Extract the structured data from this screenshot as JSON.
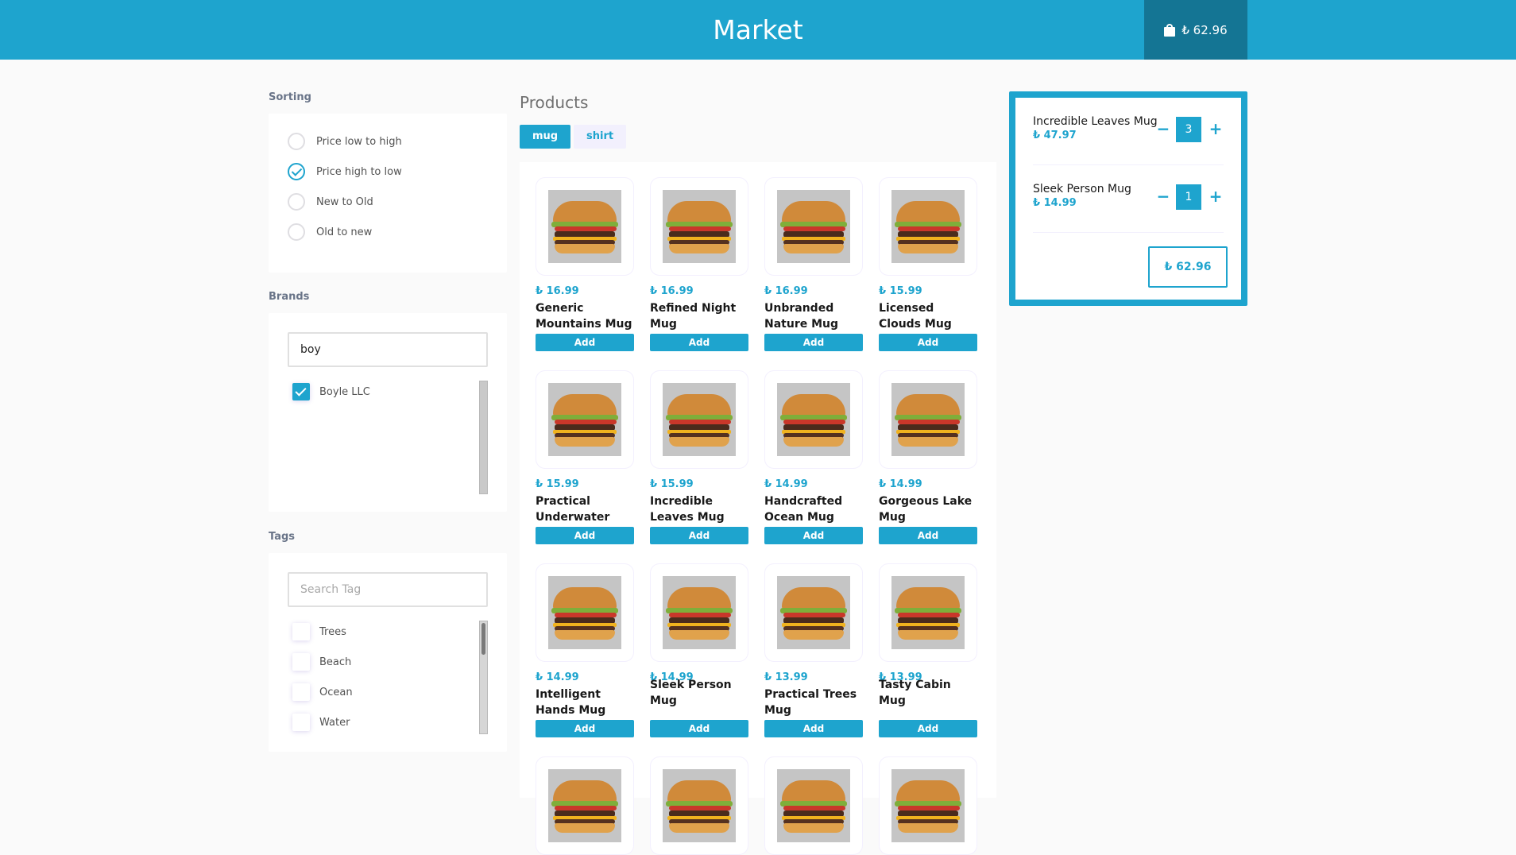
{
  "header": {
    "title": "Market",
    "basket_total": "₺ 62.96",
    "basket_icon": "shopping-bag-icon",
    "colors": {
      "brand": "#1ea4ce",
      "basket_bg": "#147594"
    }
  },
  "sorting": {
    "label": "Sorting",
    "options": [
      {
        "label": "Price low to high",
        "checked": false
      },
      {
        "label": "Price high to low",
        "checked": true
      },
      {
        "label": "New to Old",
        "checked": false
      },
      {
        "label": "Old to new",
        "checked": false
      }
    ]
  },
  "brands": {
    "label": "Brands",
    "search_value": "boy",
    "items": [
      {
        "label": "Boyle LLC",
        "checked": true
      }
    ]
  },
  "tags": {
    "label": "Tags",
    "search_placeholder": "Search Tag",
    "items": [
      {
        "label": "Trees",
        "checked": false
      },
      {
        "label": "Beach",
        "checked": false
      },
      {
        "label": "Ocean",
        "checked": false
      },
      {
        "label": "Water",
        "checked": false
      }
    ]
  },
  "products": {
    "title": "Products",
    "tabs": [
      {
        "label": "mug",
        "active": true
      },
      {
        "label": "shirt",
        "active": false
      }
    ],
    "add_label": "Add",
    "items": [
      {
        "price": "₺ 16.99",
        "name": "Generic Mountains Mug"
      },
      {
        "price": "₺ 16.99",
        "name": "Refined Night Mug"
      },
      {
        "price": "₺ 16.99",
        "name": "Unbranded Nature Mug"
      },
      {
        "price": "₺ 15.99",
        "name": "Licensed Clouds Mug"
      },
      {
        "price": "₺ 15.99",
        "name": "Practical Underwater Mug"
      },
      {
        "price": "₺ 15.99",
        "name": "Incredible Leaves Mug"
      },
      {
        "price": "₺ 14.99",
        "name": "Handcrafted Ocean Mug"
      },
      {
        "price": "₺ 14.99",
        "name": "Gorgeous Lake Mug"
      },
      {
        "price": "₺ 14.99",
        "name": "Intelligent Hands Mug"
      },
      {
        "price": "₺ 14.99",
        "name": "Sleek Person Mug"
      },
      {
        "price": "₺ 13.99",
        "name": "Practical Trees Mug"
      },
      {
        "price": "₺ 13.99",
        "name": "Tasty Cabin Mug"
      }
    ]
  },
  "basket": {
    "items": [
      {
        "name": "Incredible Leaves Mug",
        "price": "₺ 47.97",
        "qty": "3",
        "minus": "−",
        "plus": "+"
      },
      {
        "name": "Sleek Person Mug",
        "price": "₺ 14.99",
        "qty": "1",
        "minus": "−",
        "plus": "+"
      }
    ],
    "total": "₺ 62.96"
  }
}
